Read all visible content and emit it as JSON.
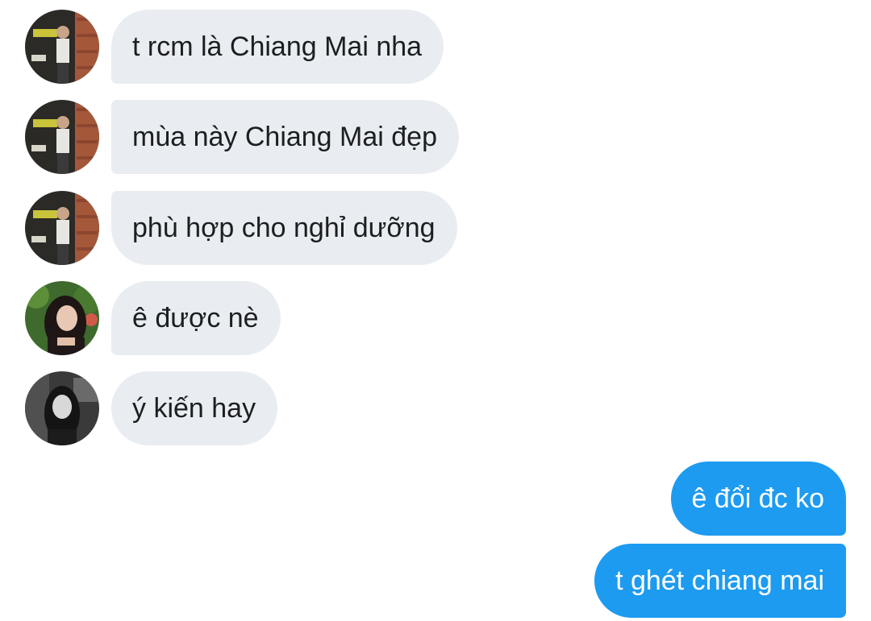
{
  "conversation": {
    "messages": [
      {
        "text": "t rcm là Chiang Mai nha",
        "direction": "incoming"
      },
      {
        "text": "mùa này Chiang Mai đẹp",
        "direction": "incoming"
      },
      {
        "text": "phù hợp cho nghỉ dưỡng",
        "direction": "incoming"
      },
      {
        "text": "ê được nè",
        "direction": "incoming"
      },
      {
        "text": "ý kiến hay",
        "direction": "incoming"
      },
      {
        "text": "ê đổi đc ko",
        "direction": "outgoing"
      },
      {
        "text": "t ghét chiang mai",
        "direction": "outgoing"
      }
    ]
  },
  "colors": {
    "incoming_bubble": "#e9edf1",
    "outgoing_bubble": "#1d9bf0",
    "incoming_text": "#1c1e21",
    "outgoing_text": "#ffffff"
  },
  "icons": {
    "avatar_a": "user-photo-icon",
    "avatar_b": "user-photo-icon",
    "avatar_c": "user-photo-icon"
  }
}
